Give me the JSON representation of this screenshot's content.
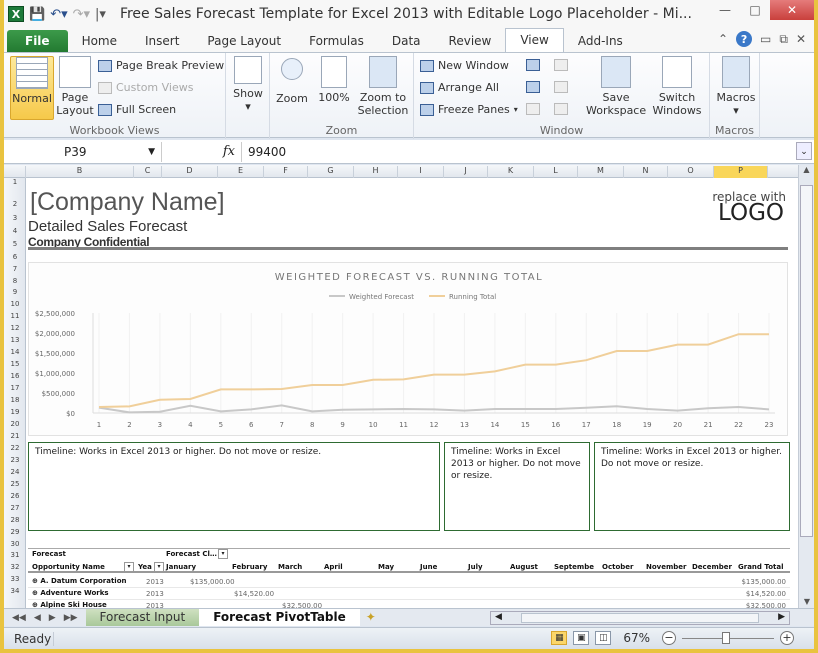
{
  "app": {
    "title": "Free Sales Forecast Template for Excel 2013 with Editable Logo Placeholder  -  Mi...",
    "qat_icons": [
      "excel-logo-icon",
      "save-icon",
      "undo-icon",
      "redo-icon",
      "customize-qat-icon"
    ]
  },
  "tabs": [
    {
      "label": "File",
      "kind": "file"
    },
    {
      "label": "Home"
    },
    {
      "label": "Insert"
    },
    {
      "label": "Page Layout"
    },
    {
      "label": "Formulas"
    },
    {
      "label": "Data"
    },
    {
      "label": "Review"
    },
    {
      "label": "View",
      "active": true
    },
    {
      "label": "Add-Ins"
    }
  ],
  "ribbon": {
    "workbook_views": {
      "label": "Workbook Views",
      "normal": "Normal",
      "page_layout": "Page\nLayout",
      "page_break_preview": "Page Break Preview",
      "custom_views": "Custom Views",
      "full_screen": "Full Screen"
    },
    "show": {
      "label": "Show"
    },
    "zoom": {
      "label": "Zoom",
      "zoom": "Zoom",
      "hundred": "100%",
      "zoom_to_selection": "Zoom to\nSelection"
    },
    "window": {
      "label": "Window",
      "new_window": "New Window",
      "arrange_all": "Arrange All",
      "freeze_panes": "Freeze Panes",
      "save_workspace": "Save\nWorkspace",
      "switch_windows": "Switch\nWindows"
    },
    "macros": {
      "label": "Macros",
      "macros": "Macros"
    }
  },
  "formula_bar": {
    "name_box": "P39",
    "fx": "fx",
    "value": "99400"
  },
  "columns": [
    "B",
    "C",
    "D",
    "E",
    "F",
    "G",
    "H",
    "I",
    "J",
    "K",
    "L",
    "M",
    "N",
    "O",
    "P"
  ],
  "selected_column": "P",
  "rows": [
    "1",
    "2",
    "3",
    "4",
    "5",
    "6",
    "7",
    "8",
    "9",
    "10",
    "11",
    "12",
    "13",
    "14",
    "15",
    "16",
    "17",
    "18",
    "19",
    "20",
    "21",
    "22",
    "23",
    "24",
    "25",
    "26",
    "27",
    "28",
    "29",
    "30",
    "31",
    "32",
    "33",
    "34"
  ],
  "sheet": {
    "company_name": "[Company Name]",
    "subtitle": "Detailed Sales Forecast",
    "confidential": "Company Confidential",
    "logo_line1": "replace with",
    "logo_line2": "LOGO"
  },
  "chart_data": {
    "type": "line",
    "title": "WEIGHTED FORECAST VS. RUNNING TOTAL",
    "xlabel": "",
    "ylabel": "",
    "legend_position": "top",
    "grid": true,
    "x": [
      1,
      2,
      3,
      4,
      5,
      6,
      7,
      8,
      9,
      10,
      11,
      12,
      13,
      14,
      15,
      16,
      17,
      18,
      19,
      20,
      21,
      22,
      23
    ],
    "y_ticks": [
      "$0",
      "$500,000",
      "$1,000,000",
      "$1,500,000",
      "$2,000,000",
      "$2,500,000"
    ],
    "ylim": [
      0,
      2500000
    ],
    "series": [
      {
        "name": "Weighted Forecast",
        "color": "#c8c8c8",
        "values": [
          135000,
          14520,
          32500,
          180000,
          40000,
          90000,
          190000,
          40000,
          80000,
          90000,
          100000,
          90000,
          60000,
          100000,
          100000,
          100000,
          130000,
          170000,
          100000,
          60000,
          120000,
          150000,
          90000
        ]
      },
      {
        "name": "Running Total",
        "color": "#f0cf9a",
        "values": [
          150000,
          165000,
          330000,
          350000,
          590000,
          590000,
          600000,
          700000,
          700000,
          830000,
          840000,
          960000,
          960000,
          1040000,
          1210000,
          1210000,
          1320000,
          1550000,
          1550000,
          1710000,
          1710000,
          1970000,
          1970000
        ]
      }
    ]
  },
  "timelines": [
    "Timeline:  Works in Excel 2013 or higher. Do not move or resize.",
    "Timeline:  Works in Excel 2013 or higher. Do not move or resize.",
    "Timeline:  Works in Excel 2013 or higher. Do not move or resize."
  ],
  "pivot": {
    "row30_a": "Forecast",
    "row30_b": "Forecast Cl…",
    "headers": [
      "Opportunity Name",
      "Yea",
      "January",
      "February",
      "March",
      "April",
      "May",
      "June",
      "July",
      "August",
      "Septembe",
      "October",
      "November",
      "December",
      "Grand Total"
    ],
    "rows": [
      {
        "name": "A. Datum Corporation",
        "year": "2013",
        "value": "$135,000.00",
        "month_index": 0,
        "total": "$135,000.00"
      },
      {
        "name": "Adventure Works",
        "year": "2013",
        "value": "$14,520.00",
        "month_index": 1,
        "total": "$14,520.00"
      },
      {
        "name": "Alpine Ski House",
        "year": "2013",
        "value": "$32,500.00",
        "month_index": 2,
        "total": "$32,500.00"
      }
    ]
  },
  "sheet_tabs": [
    {
      "label": "Forecast Input"
    },
    {
      "label": "Forecast PivotTable",
      "active": true
    }
  ],
  "status": {
    "ready": "Ready",
    "zoom": "67%"
  }
}
